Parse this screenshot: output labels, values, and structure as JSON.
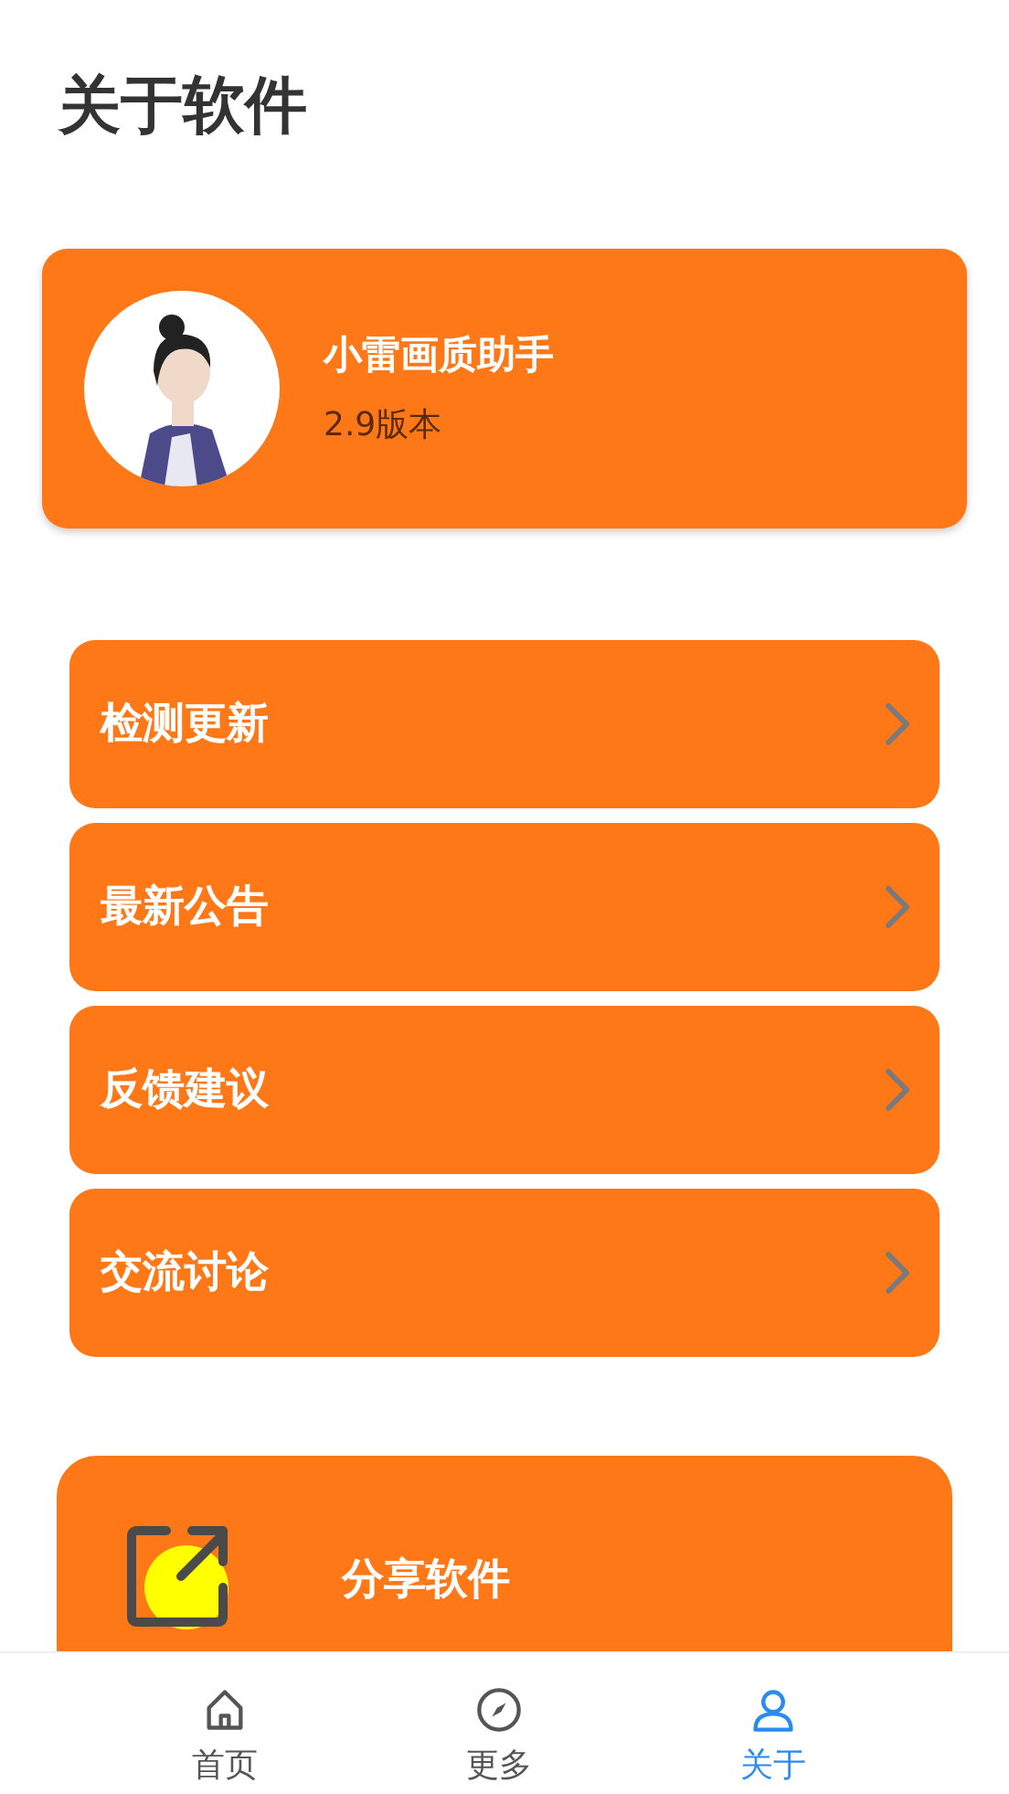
{
  "header": {
    "title": "关于软件"
  },
  "app_card": {
    "name": "小雷画质助手",
    "version": "2.9版本"
  },
  "menu": [
    {
      "label": "检测更新"
    },
    {
      "label": "最新公告"
    },
    {
      "label": "反馈建议"
    },
    {
      "label": "交流讨论"
    }
  ],
  "share": {
    "label": "分享软件"
  },
  "tab_bar": [
    {
      "label": "首页",
      "selected": false
    },
    {
      "label": "更多",
      "selected": false
    },
    {
      "label": "关于",
      "selected": true
    }
  ]
}
